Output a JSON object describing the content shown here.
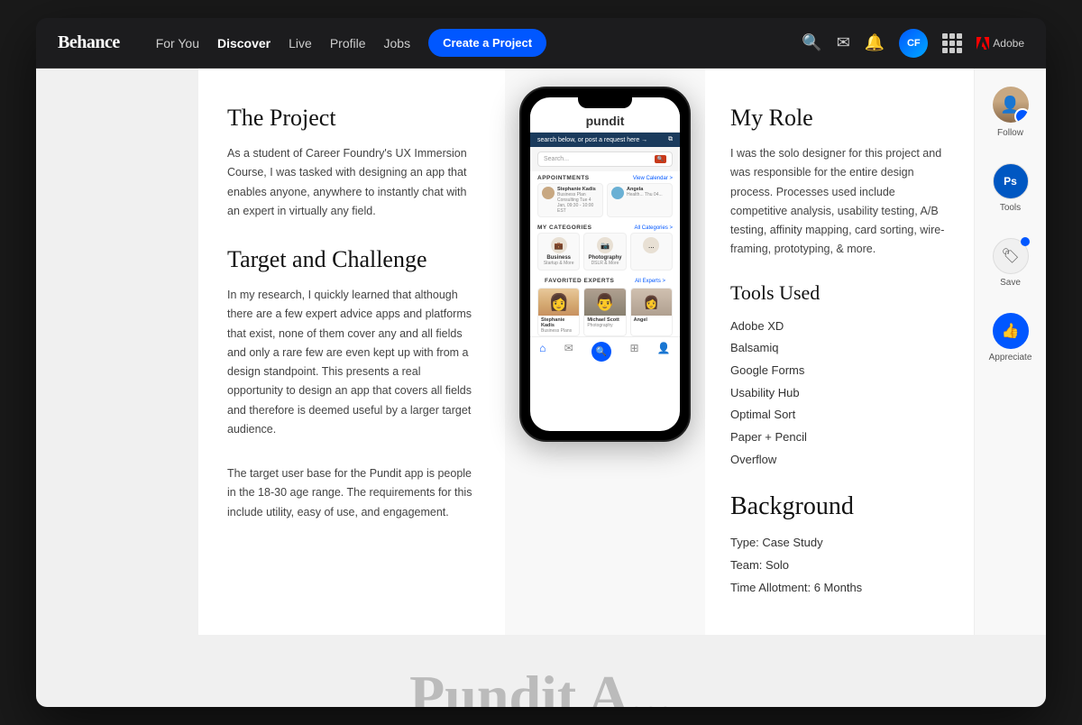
{
  "nav": {
    "logo": "Behance",
    "links": [
      {
        "label": "For You",
        "active": false
      },
      {
        "label": "Discover",
        "active": true
      },
      {
        "label": "Live",
        "active": false
      },
      {
        "label": "Profile",
        "active": false
      },
      {
        "label": "Jobs",
        "active": false
      }
    ],
    "cta": "Create a Project",
    "avatar_initials": "CF",
    "adobe_label": "Adobe"
  },
  "project": {
    "title": "The Project",
    "body1": "As a student of Career Foundry's UX Immersion Course, I was tasked with designing an app that enables anyone, anywhere to instantly chat with an expert in virtually any field.",
    "target_title": "Target and Challenge",
    "body2": "In my research, I quickly learned that although there are a few expert advice apps and platforms that exist, none of them cover any and all fields and only a rare few are even kept up with from a design standpoint. This presents a real opportunity to design an app that covers all fields and therefore is deemed useful by a larger target audience.",
    "body3": "The target user base for the Pundit app is people in the 18-30 age range. The requirements for this include utility, easy of use, and engagement."
  },
  "phone": {
    "app_name": "pundit",
    "banner": "search below, or post a request here →",
    "search_placeholder": "Search...",
    "appointments_label": "APPOINTMENTS",
    "view_calendar": "View Calendar >",
    "appt1_name": "Stephanie Kadis",
    "appt1_sub": "Business Plan Consulting\nTue 4 Jan, 09:30 - 10:00 EST",
    "appt2_name": "Angela",
    "appt2_sub": "Health...\nThu 04...",
    "my_categories": "MY CATEGORIES",
    "all_categories": "All Categories >",
    "cat1_name": "Business",
    "cat1_sub": "Startup & More",
    "cat2_name": "Photography",
    "cat2_sub": "DSLR & More",
    "favorited_experts": "FAVORITED EXPERTS",
    "all_experts": "All Experts >",
    "expert1_name": "Stephanie Kadis",
    "expert1_field": "Business Plans",
    "expert2_name": "Michael Scott",
    "expert2_field": "Photography",
    "expert3_name": "Angel"
  },
  "my_role": {
    "title": "My Role",
    "body": "I was the solo designer for this project and was responsible for the entire design process. Processes used include competitive analysis, usability testing, A/B testing, affinity mapping, card sorting, wire-framing, prototyping, & more."
  },
  "tools": {
    "title": "Tools Used",
    "items": [
      "Adobe XD",
      "Balsamiq",
      "Google Forms",
      "Usability Hub",
      "Optimal Sort",
      "Paper + Pencil",
      "Overflow"
    ]
  },
  "background": {
    "title": "Background",
    "type": "Type: Case Study",
    "team": "Team: Solo",
    "time": "Time Allotment: 6 Months"
  },
  "sidebar": {
    "follow_label": "Follow",
    "tools_label": "Tools",
    "save_label": "Save",
    "appreciate_label": "Appreciate"
  },
  "bottom_text": "Pundit A...",
  "icons": {
    "search": "🔍",
    "mail": "✉",
    "bell": "🔔",
    "grid": "⠿",
    "thumbsup": "👍",
    "save": "🏷",
    "home": "⌂",
    "envelope": "✉",
    "search_small": "🔍",
    "grid_small": "⊞",
    "person": "👤"
  }
}
